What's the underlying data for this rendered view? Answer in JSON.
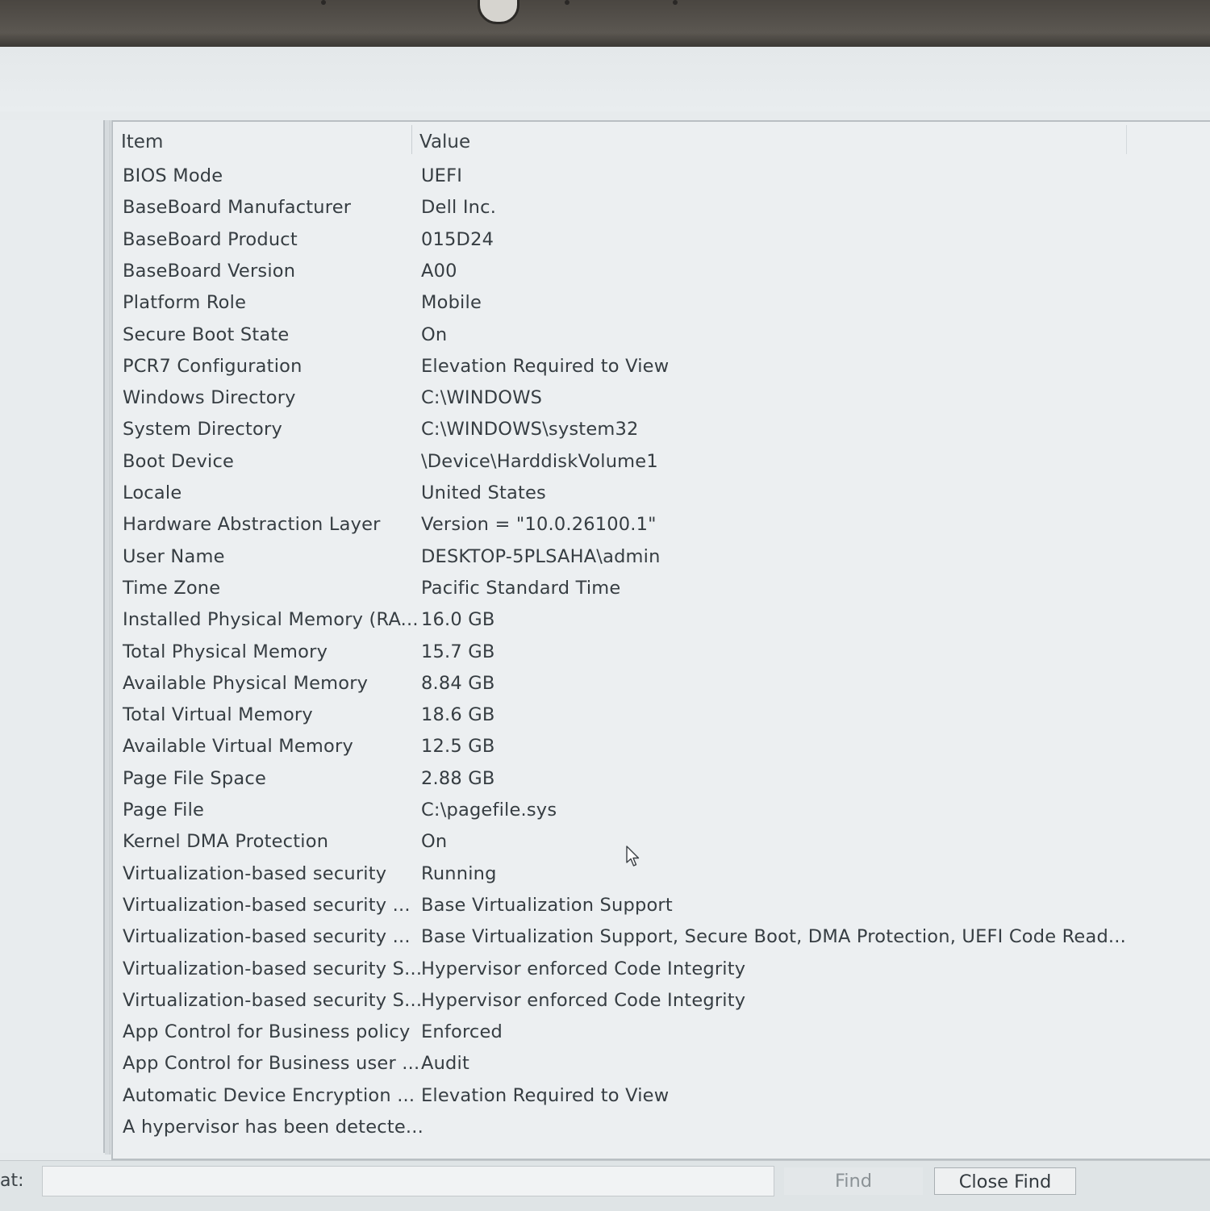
{
  "list": {
    "columns": {
      "item": "Item",
      "value": "Value"
    },
    "rows": [
      {
        "item": "BIOS Mode",
        "value": "UEFI"
      },
      {
        "item": "BaseBoard Manufacturer",
        "value": "Dell Inc."
      },
      {
        "item": "BaseBoard Product",
        "value": "015D24"
      },
      {
        "item": "BaseBoard Version",
        "value": "A00"
      },
      {
        "item": "Platform Role",
        "value": "Mobile"
      },
      {
        "item": "Secure Boot State",
        "value": "On"
      },
      {
        "item": "PCR7 Configuration",
        "value": "Elevation Required to View"
      },
      {
        "item": "Windows Directory",
        "value": "C:\\WINDOWS"
      },
      {
        "item": "System Directory",
        "value": "C:\\WINDOWS\\system32"
      },
      {
        "item": "Boot Device",
        "value": "\\Device\\HarddiskVolume1"
      },
      {
        "item": "Locale",
        "value": "United States"
      },
      {
        "item": "Hardware Abstraction Layer",
        "value": "Version = \"10.0.26100.1\""
      },
      {
        "item": "User Name",
        "value": "DESKTOP-5PLSAHA\\admin"
      },
      {
        "item": "Time Zone",
        "value": "Pacific Standard Time"
      },
      {
        "item": "Installed Physical Memory (RA...",
        "value": "16.0 GB"
      },
      {
        "item": "Total Physical Memory",
        "value": "15.7 GB"
      },
      {
        "item": "Available Physical Memory",
        "value": "8.84 GB"
      },
      {
        "item": "Total Virtual Memory",
        "value": "18.6 GB"
      },
      {
        "item": "Available Virtual Memory",
        "value": "12.5 GB"
      },
      {
        "item": "Page File Space",
        "value": "2.88 GB"
      },
      {
        "item": "Page File",
        "value": "C:\\pagefile.sys"
      },
      {
        "item": "Kernel DMA Protection",
        "value": "On"
      },
      {
        "item": "Virtualization-based security",
        "value": "Running"
      },
      {
        "item": "Virtualization-based security ...",
        "value": "Base Virtualization Support"
      },
      {
        "item": "Virtualization-based security ...",
        "value": "Base Virtualization Support, Secure Boot, DMA Protection, UEFI Code Read..."
      },
      {
        "item": "Virtualization-based security S...",
        "value": "Hypervisor enforced Code Integrity"
      },
      {
        "item": "Virtualization-based security S...",
        "value": "Hypervisor enforced Code Integrity"
      },
      {
        "item": "App Control for Business policy",
        "value": "Enforced"
      },
      {
        "item": "App Control for Business user ...",
        "value": "Audit"
      },
      {
        "item": "Automatic Device Encryption ...",
        "value": "Elevation Required to View"
      },
      {
        "item": "A hypervisor has been detecte...",
        "value": ""
      }
    ]
  },
  "find_bar": {
    "label": "at:",
    "input_value": "",
    "find_label": "Find",
    "close_label": "Close Find"
  },
  "icons": {
    "cursor": "mouse-pointer-icon",
    "camera": "webcam-icon"
  }
}
